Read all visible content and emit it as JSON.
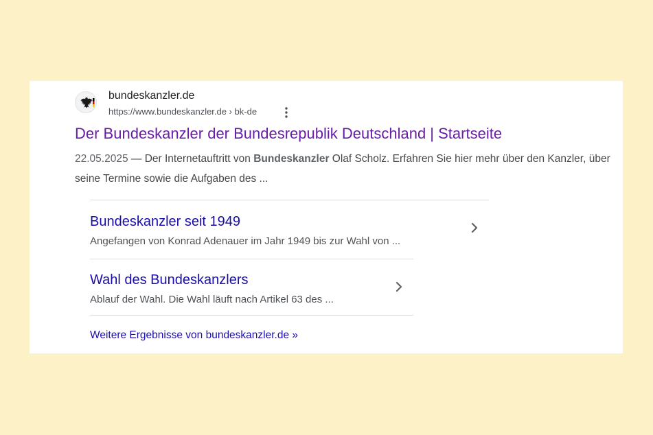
{
  "result": {
    "favicon_icon": "german-eagle-icon",
    "site_name": "bundeskanzler.de",
    "site_url": "https://www.bundeskanzler.de › bk-de",
    "more_icon": "vertical-dots-icon",
    "title": "Der Bundeskanzler der Bundesrepublik Deutschland | Startseite",
    "snippet": {
      "date": "22.05.2025",
      "prefix": " — Der Internetauftritt von ",
      "bold": "Bundeskanzler",
      "suffix": " Olaf Scholz. Erfahren Sie hier mehr über den Kanzler, über seine Termine sowie die Aufgaben des ..."
    }
  },
  "sitelinks": [
    {
      "title": "Bundeskanzler seit 1949",
      "description": "Angefangen von Konrad Adenauer im Jahr 1949 bis zur Wahl von ...",
      "icon": "chevron-right-icon"
    },
    {
      "title": "Wahl des Bundeskanzlers",
      "description": "Ablauf der Wahl. Die Wahl läuft nach Artikel 63 des ...",
      "icon": "chevron-right-icon"
    }
  ],
  "more_results": "Weitere Ergebnisse von bundeskanzler.de »",
  "colors": {
    "background": "#fdf2c7",
    "visited_link": "#681da8",
    "link": "#1a0dab"
  }
}
